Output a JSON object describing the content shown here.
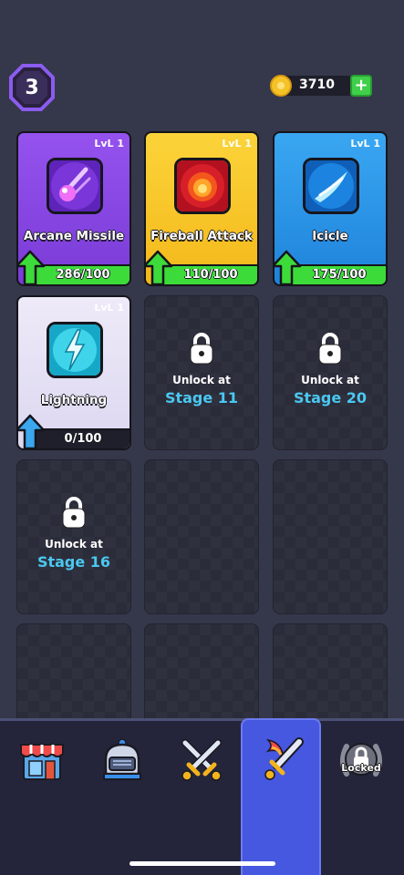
{
  "player": {
    "level": "3"
  },
  "currency": {
    "coins": "3710",
    "add_label": "+"
  },
  "skills": [
    {
      "name": "Arcane Missile",
      "level": "LvL 1",
      "progress_text": "286/100",
      "progress": 1.0,
      "color": "#8d45e6"
    },
    {
      "name": "Fireball Attack",
      "level": "LvL 1",
      "progress_text": "110/100",
      "progress": 1.0,
      "color": "#f7c51a"
    },
    {
      "name": "Icicle",
      "level": "LvL 1",
      "progress_text": "175/100",
      "progress": 1.0,
      "color": "#2c9be8"
    },
    {
      "name": "Lightning",
      "level": "LvL 1",
      "progress_text": "0/100",
      "progress": 0.0,
      "color": "#e7e5f8"
    }
  ],
  "locked_slots": [
    {
      "unlock_label": "Unlock at",
      "stage": "Stage 11"
    },
    {
      "unlock_label": "Unlock at",
      "stage": "Stage 20"
    },
    {
      "unlock_label": "Unlock at",
      "stage": "Stage 16"
    }
  ],
  "nav": {
    "tabs": [
      {
        "name": "shop",
        "icon": "shop-icon"
      },
      {
        "name": "hero",
        "icon": "helmet-icon"
      },
      {
        "name": "battle",
        "icon": "crossed-swords-icon"
      },
      {
        "name": "skills",
        "icon": "flaming-sword-icon",
        "active": true
      },
      {
        "name": "locked",
        "icon": "laurel-lock-icon",
        "label": "Locked"
      }
    ]
  },
  "colors": {
    "background": "#35374a",
    "progress_green": "#3ddb3a",
    "stage_blue": "#4ac8f0",
    "active_tab": "#4657e0"
  }
}
